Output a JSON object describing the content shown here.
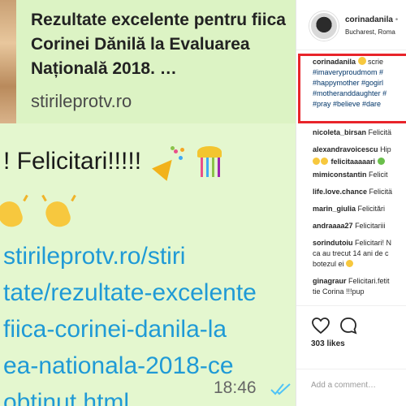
{
  "chat": {
    "card_title": "Rezultate excelente pentru fiica Corinei Dănilă la Evaluarea Națională 2018. …",
    "card_domain": "stirileprotv.ro",
    "message_text": "! Felicitari!!!!!",
    "url_lines": [
      "stirileprotv.ro/stiri",
      "tate/rezultate-excelente",
      "fiica-corinei-danila-la",
      "ea-nationala-2018-ce",
      "obtinut.html"
    ],
    "time": "18:46",
    "tick_color": "#4fc3f7"
  },
  "instagram": {
    "header": {
      "username": "corinadanila",
      "separator": "•",
      "location": "Bucharest, Roma"
    },
    "caption": {
      "username": "corinadanila",
      "text_after_emoji": "scrie",
      "hashtag_lines": [
        "#imaveryproudmom #",
        "#happymother #gogirl",
        "#motheranddaughter #",
        "#pray #believe #dare"
      ]
    },
    "comments": [
      {
        "user": "nicoleta_birsan",
        "text": "Felicitä"
      },
      {
        "user": "alexandravoicescu",
        "text": "Hip",
        "line2": ""
      },
      {
        "user": "felicitaaaaari",
        "text": ""
      },
      {
        "user": "mimiconstantin",
        "text": "Felicit"
      },
      {
        "user": "life.love.chance",
        "text": "Felicitä"
      },
      {
        "user": "marin_giulia",
        "text": "Felicitări"
      },
      {
        "user": "andraaaa27",
        "text": "Felicitariii"
      },
      {
        "user": "sorindutoiu",
        "text": "Felicitari! N",
        "line2": "ca au trecut 14 ani de c",
        "line3": "botezul ei"
      },
      {
        "user": "ginagraur",
        "text": "Felicitari.fetit",
        "line2": "tie Corina !!!pup"
      }
    ],
    "likes": "303 likes",
    "add_comment_placeholder": "Add a comment…",
    "accent_red": "#e8242a"
  }
}
